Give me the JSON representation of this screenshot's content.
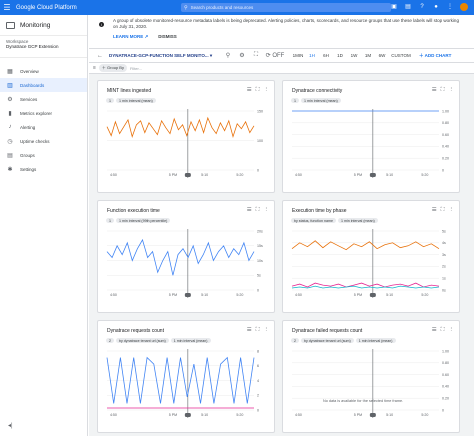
{
  "topbar": {
    "brand": "Google Cloud Platform",
    "search_placeholder": "Search products and resources"
  },
  "sidebar": {
    "title": "Monitoring",
    "workspace_label": "Workspace",
    "workspace_name": "Dynatrace GCP Extension",
    "items": [
      {
        "label": "Overview",
        "icon": "chart-icon"
      },
      {
        "label": "Dashboards",
        "icon": "dashboard-icon"
      },
      {
        "label": "Services",
        "icon": "services-icon"
      },
      {
        "label": "Metrics explorer",
        "icon": "bar-chart-icon"
      },
      {
        "label": "Alerting",
        "icon": "bell-icon"
      },
      {
        "label": "Uptime checks",
        "icon": "uptime-icon"
      },
      {
        "label": "Groups",
        "icon": "groups-icon"
      },
      {
        "label": "Settings",
        "icon": "gear-icon"
      }
    ],
    "active_index": 1
  },
  "banner": {
    "text": "A group of obsolete monitored-resource metadata labels is being deprecated. Alerting policies, charts, scorecards, and resource groups that use these labels will stop working on July 31, 2020.",
    "learn_more": "LEARN MORE",
    "dismiss": "DISMISS"
  },
  "toolbar": {
    "dashboard_name": "DYNATRACE-GCP-FUNCTION SELF MONITO...",
    "auto_refresh": "OFF",
    "ranges": [
      "1MIN",
      "1H",
      "6H",
      "1D",
      "1W",
      "1M",
      "6W",
      "CUSTOM"
    ],
    "selected_range": "1H",
    "add_chart": "ADD CHART"
  },
  "filter": {
    "chip": "Group By",
    "placeholder": "Filter..."
  },
  "charts": [
    {
      "title": "MINT lines ingested",
      "chips": [
        "1",
        "1 min interval (mean)"
      ],
      "yticks": [
        "150",
        "100",
        "0"
      ],
      "xticks": [
        "4:50",
        "5 PM",
        "5:10",
        "5:20"
      ],
      "chart_data": {
        "type": "line",
        "title": "MINT lines ingested",
        "ylim": [
          0,
          300
        ],
        "series": [
          {
            "color": "#e8710a",
            "values": [
              220,
              175,
              245,
              185,
              220,
              255,
              170,
              230,
              250,
              190,
              240,
              210,
              180,
              250,
              215,
              185,
              260,
              205,
              230,
              175,
              245,
              200,
              255,
              190,
              265,
              215,
              185,
              240,
              200,
              250,
              170,
              235,
              210,
              245,
              190,
              225
            ]
          }
        ]
      }
    },
    {
      "title": "Dynatrace connectivity",
      "chips": [
        "1",
        "1 min interval (mean)"
      ],
      "yticks": [
        "1.00",
        "0.80",
        "0.60",
        "0.40",
        "0.20",
        "0"
      ],
      "xticks": [
        "4:50",
        "5 PM",
        "5:10",
        "5:20"
      ],
      "chart_data": {
        "type": "line",
        "title": "Dynatrace connectivity",
        "ylim": [
          0,
          1
        ],
        "series": [
          {
            "color": "#4285f4",
            "values": [
              1,
              1,
              1,
              1,
              1,
              1,
              1,
              1,
              1,
              1,
              1,
              1,
              1,
              1,
              1,
              1,
              1,
              1,
              1,
              1
            ]
          }
        ]
      }
    },
    {
      "title": "Function execution time",
      "chips": [
        "1",
        "1 min interval (99th percentile)"
      ],
      "yticks": [
        "20s",
        "15s",
        "10s",
        "5s",
        "0"
      ],
      "xticks": [
        "4:50",
        "5 PM",
        "5:10",
        "5:20"
      ],
      "chart_data": {
        "type": "line",
        "title": "Function execution time",
        "ylim": [
          0,
          20
        ],
        "series": [
          {
            "color": "#4285f4",
            "values": [
              13,
              11,
              15,
              12,
              16,
              10,
              14,
              17,
              11,
              13,
              6,
              10,
              13,
              5,
              12,
              14,
              11,
              15,
              9,
              12,
              16,
              10,
              13,
              15,
              11,
              14,
              12,
              16,
              10,
              13
            ]
          }
        ]
      }
    },
    {
      "title": "Execution time by phase",
      "chips": [
        "by status, function name",
        "1 min interval (mean)"
      ],
      "yticks": [
        "5s",
        "4s",
        "3s",
        "2s",
        "1s",
        "0s"
      ],
      "xticks": [
        "4:50",
        "5 PM",
        "5:10",
        "5:20"
      ],
      "chart_data": {
        "type": "line",
        "title": "Execution time by phase",
        "ylim": [
          0,
          6
        ],
        "series": [
          {
            "color": "#e8710a",
            "values": [
              4.2,
              4.8,
              4.4,
              5.0,
              4.3,
              4.9,
              4.5,
              4.1,
              4.7,
              4.4,
              4.9,
              4.2,
              4.6,
              4.8,
              4.3,
              4.5,
              4.9,
              4.4,
              4.7,
              4.2
            ]
          },
          {
            "color": "#e52592",
            "values": [
              0.4,
              0.6,
              0.3,
              0.7,
              0.5,
              0.4,
              0.6,
              0.3,
              0.5,
              0.7,
              0.4,
              0.6,
              0.3,
              0.5,
              0.6,
              0.4,
              0.7,
              0.3,
              0.5,
              0.4
            ]
          },
          {
            "color": "#12b5cb",
            "values": [
              0.2,
              0.3,
              0.2,
              0.4,
              0.2,
              0.3,
              0.2,
              0.3,
              0.4,
              0.2,
              0.3,
              0.2,
              0.3,
              0.2,
              0.4,
              0.3,
              0.2,
              0.3,
              0.2,
              0.3
            ]
          }
        ]
      }
    },
    {
      "title": "Dynatrace requests count",
      "chips": [
        "2",
        "by dynatrace tenant url (sum)",
        "1 min interval (mean)"
      ],
      "yticks": [
        "8",
        "6",
        "4",
        "2",
        "0"
      ],
      "xticks": [
        "4:50",
        "5 PM",
        "5:10",
        "5:20"
      ],
      "chart_data": {
        "type": "line",
        "title": "Dynatrace requests count",
        "ylim": [
          0,
          9
        ],
        "series": [
          {
            "color": "#4285f4",
            "values": [
              8,
              1,
              8,
              1,
              8,
              1,
              8,
              7,
              1,
              8,
              1,
              8,
              2,
              7,
              1,
              8,
              1,
              7,
              8,
              1,
              8,
              1,
              8
            ]
          },
          {
            "color": "#e52592",
            "values": [
              0.3,
              0.3,
              0.3,
              0.3,
              0.3,
              0.3,
              0.3,
              0.3,
              0.3,
              0.3,
              0.3,
              0.3
            ]
          }
        ]
      }
    },
    {
      "title": "Dynatrace failed requests count",
      "chips": [
        "2",
        "by dynatrace tenant url (sum)",
        "1 min interval (mean)"
      ],
      "yticks": [
        "1.00",
        "0.80",
        "0.60",
        "0.40",
        "0.20",
        "0"
      ],
      "xticks": [
        "4:50",
        "5 PM",
        "5:10",
        "5:20"
      ],
      "nodata": "No data is available for the selected time frame.",
      "chart_data": {
        "type": "line",
        "title": "Dynatrace failed requests count",
        "ylim": [
          0,
          1
        ],
        "series": []
      }
    }
  ]
}
